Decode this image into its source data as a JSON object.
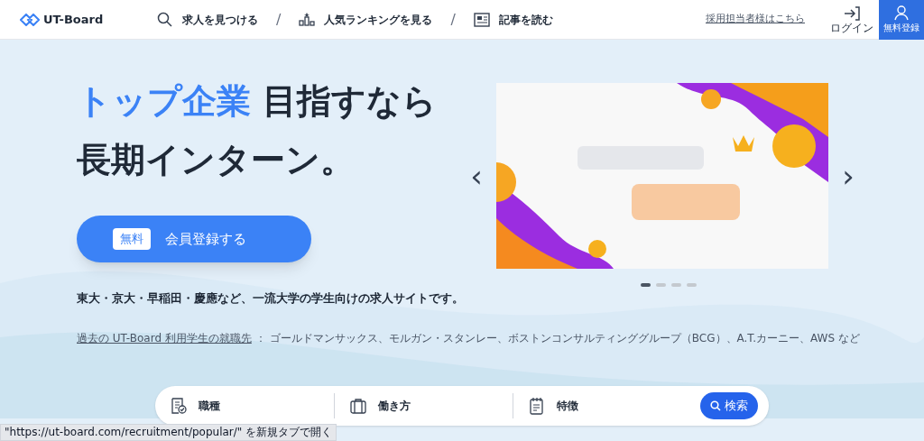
{
  "header": {
    "logo": "UT-Board",
    "nav": [
      {
        "kind": "search",
        "label": "求人を見つける"
      },
      {
        "kind": "ranking",
        "label": "人気ランキングを見る"
      },
      {
        "kind": "article",
        "label": "記事を読む"
      }
    ],
    "separator": "/",
    "recruiter_link": "採用担当者様はこちら",
    "login": "ログイン",
    "signup": "無料登録"
  },
  "hero": {
    "headline_accent": "トップ企業",
    "headline_rest": "目指すなら",
    "headline_line2": "長期インターン。",
    "cta_badge": "無料",
    "cta_label": "会員登録する",
    "tagline": "東大・京大・早稲田・慶應など、一流大学の学生向けの求人サイトです。",
    "employers_link": "過去の UT-Board 利用学生の就職先",
    "employers_sep": "：",
    "employers": "ゴールドマンサックス、モルガン・スタンレー、ボストンコンサルティンググループ（BCG）、A.T.カーニー、AWS など"
  },
  "carousel": {
    "prev": "‹",
    "next": "›",
    "dots": [
      {
        "selected": true
      },
      {
        "selected": false
      },
      {
        "selected": false
      },
      {
        "selected": false
      }
    ]
  },
  "search_bar": {
    "filters": [
      {
        "kind": "job",
        "label": "職種"
      },
      {
        "kind": "style",
        "label": "働き方"
      },
      {
        "kind": "feature",
        "label": "特徴"
      }
    ],
    "button": "検索"
  },
  "status_tooltip": "\"https://ut-board.com/recruitment/popular/\" を新規タブで開く"
}
